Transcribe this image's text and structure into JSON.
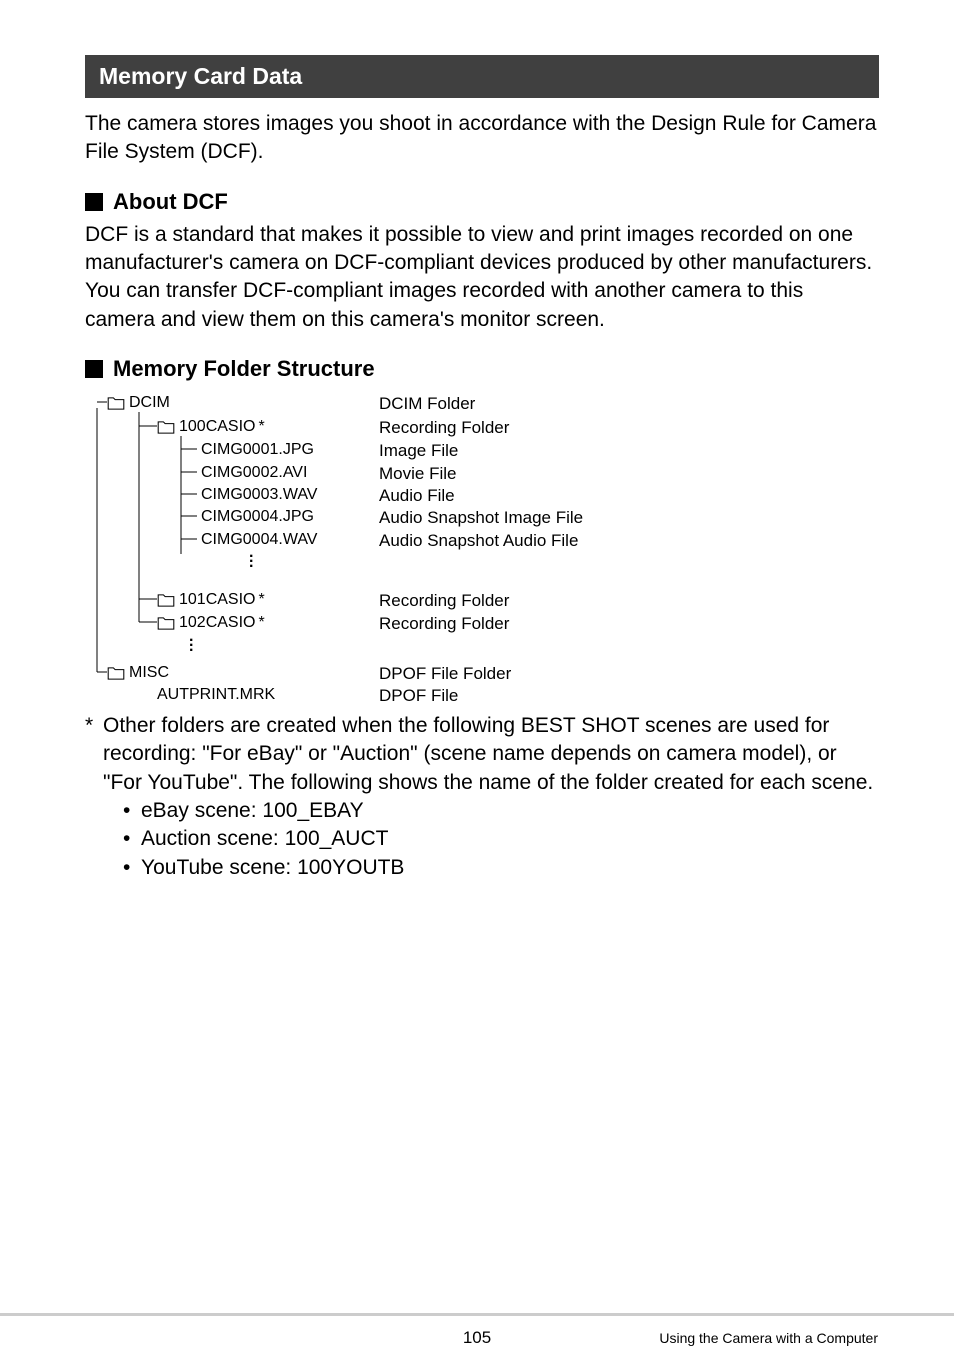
{
  "section_header": "Memory Card Data",
  "intro_text": "The camera stores images you shoot in accordance with the Design Rule for Camera File System (DCF).",
  "about_dcf_title": "About DCF",
  "about_dcf_text": "DCF is a standard that makes it possible to view and print images recorded on one manufacturer's camera on DCF-compliant devices produced by other manufacturers. You can transfer DCF-compliant images recorded with another camera to this camera and view them on this camera's monitor screen.",
  "folder_structure_title": "Memory Folder Structure",
  "tree": {
    "dcim": "DCIM",
    "dcim_label": "DCIM Folder",
    "f100": "100CASIO",
    "f100_label": "Recording Folder",
    "file1": "CIMG0001.JPG",
    "file1_label": "Image File",
    "file2": "CIMG0002.AVI",
    "file2_label": "Movie File",
    "file3": "CIMG0003.WAV",
    "file3_label": "Audio File",
    "file4": "CIMG0004.JPG",
    "file4_label": "Audio Snapshot Image File",
    "file5": "CIMG0004.WAV",
    "file5_label": "Audio Snapshot Audio File",
    "f101": "101CASIO",
    "f101_label": "Recording Folder",
    "f102": "102CASIO",
    "f102_label": "Recording Folder",
    "misc": "MISC",
    "misc_label": "DPOF File Folder",
    "autprint": "AUTPRINT.MRK",
    "autprint_label": "DPOF File",
    "star": "*"
  },
  "footnote_star": "*",
  "footnote_text": "Other folders are created when the following BEST SHOT scenes are used for recording: \"For eBay\" or \"Auction\" (scene name depends on camera model), or \"For YouTube\". The following shows the name of the folder created for each scene.",
  "bullets": {
    "b1": "eBay scene: 100_EBAY",
    "b2": "Auction scene: 100_AUCT",
    "b3": "YouTube scene: 100YOUTB"
  },
  "page_number": "105",
  "footer_text": "Using the Camera with a Computer"
}
